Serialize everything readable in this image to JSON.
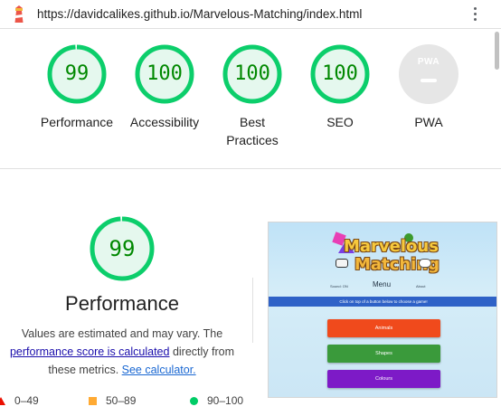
{
  "url_bar": {
    "url": "https://davidcalikes.github.io/Marvelous-Matching/index.html"
  },
  "colors": {
    "pass": "#0cce6b",
    "pass_text": "#008800",
    "average": "#ffaa33",
    "fail": "#eb0f00",
    "na": "#e6e6e6"
  },
  "gauges": [
    {
      "label": "Performance",
      "score": "99",
      "value": 0.99
    },
    {
      "label": "Accessibility",
      "score": "100",
      "value": 1.0
    },
    {
      "label": "Best Practices",
      "score": "100",
      "value": 1.0
    },
    {
      "label": "SEO",
      "score": "100",
      "value": 1.0
    },
    {
      "label": "PWA",
      "score": "",
      "value": null,
      "badge": "PWA"
    }
  ],
  "performance": {
    "score": "99",
    "value": 0.99,
    "title": "Performance",
    "desc_line1": "Values are estimated and may vary. The",
    "desc_link1": "performance score is calculated",
    "desc_mid": " directly from",
    "desc_line3": "these metrics. ",
    "desc_link2": "See calculator."
  },
  "legend": [
    {
      "range": "0–49",
      "shape": "triangle"
    },
    {
      "range": "50–89",
      "shape": "square"
    },
    {
      "range": "90–100",
      "shape": "circle"
    }
  ],
  "screenshot": {
    "logo_line1": "Marvelous",
    "logo_line2": "Matching",
    "menu_left": "Sound: ON",
    "menu_title": "Menu",
    "menu_right": "About",
    "instruction": "Click on top of a button below to choose a game!",
    "buttons": [
      "Animals",
      "Shapes",
      "Colours"
    ]
  },
  "icons": {
    "logo": "lighthouse-icon",
    "menu": "kebab-menu-icon"
  }
}
